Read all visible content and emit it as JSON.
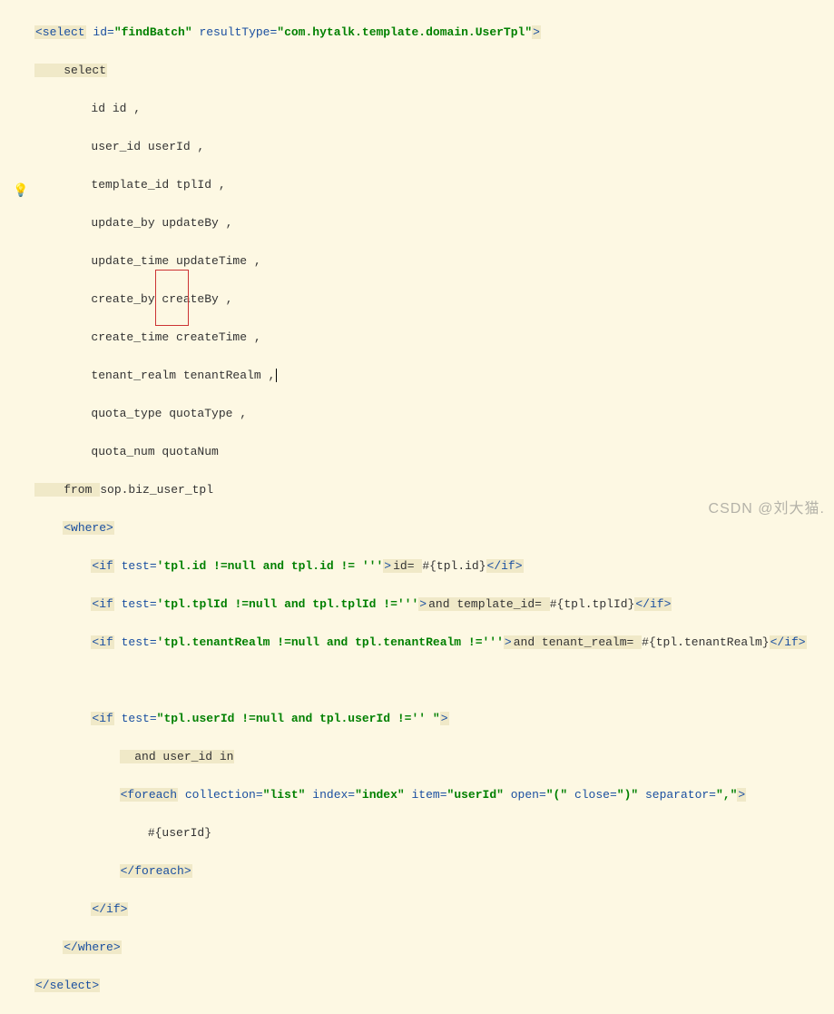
{
  "watermark": "CSDN @刘大猫.",
  "code": {
    "l1_open": "<select",
    "l1_idAttr": " id=",
    "l1_idVal": "\"findBatch\"",
    "l1_rtAttr": " resultType=",
    "l1_rtVal": "\"com.hytalk.template.domain.UserTpl\"",
    "l1_close": ">",
    "l2": "    select",
    "l3": "        id id ,",
    "l4": "        user_id userId ,",
    "l5": "        template_id tplId ,",
    "l6": "        update_by updateBy ,",
    "l7": "        update_time updateTime ,",
    "l8": "        create_by createBy ,",
    "l9": "        create_time createTime ,",
    "l10": "        tenant_realm tenantRealm ,",
    "l11": "        quota_type quotaType ,",
    "l12": "        quota_num quotaNum",
    "l13a": "    from ",
    "l13b": "sop.biz_user_tpl",
    "l14": "<where>",
    "if1_open": "<if",
    "if_testAttr": " test=",
    "if1_test": "'tpl.id !=null and tpl.id != '''",
    "if1_close": ">",
    "if1_body_a": "id= ",
    "if1_body_b": "#{tpl.id}",
    "end_if": "</if>",
    "if2_test": "'tpl.tplId !=null and tpl.tplId !='''",
    "if2_body_a": "and template_id= ",
    "if2_body_b": "#{tpl.tplId}",
    "if3_test": "'tpl.tenantRealm !=null and tpl.tenantRealm !='''",
    "if3_body_a": "and tenant_realm= ",
    "if3_body_b": "#{tpl.tenantRealm}",
    "if4_test": "\"tpl.userId !=null and tpl.userId !='' \"",
    "if4_body": "  and user_id in",
    "fe_open": "<foreach",
    "fe_collAttr": " collection=",
    "fe_collVal": "\"list\"",
    "fe_idxAttr": " index=",
    "fe_idxVal": "\"index\"",
    "fe_itemAttr": " item=",
    "fe_itemVal": "\"userId\"",
    "fe_openAttr": " open=",
    "fe_openVal": "\"(\"",
    "fe_closeAttr": " close=",
    "fe_closeVal": "\")\"",
    "fe_sepAttr": " separator=",
    "fe_sepVal": "\",\"",
    "fe_close": ">",
    "fe_body": "#{userId}",
    "fe_end": "</foreach>",
    "where_end": "</where>",
    "sel_end": "</select>"
  }
}
